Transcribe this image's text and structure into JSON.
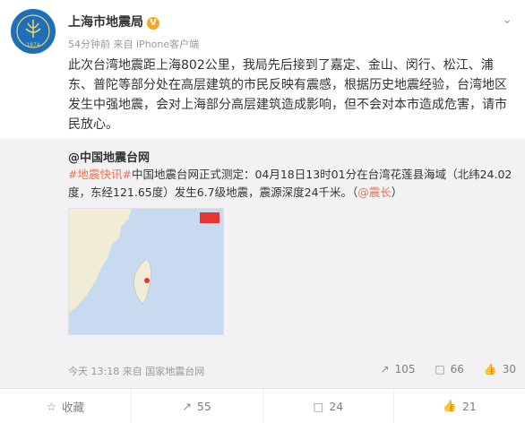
{
  "post": {
    "author": "上海市地震局",
    "verified_badge": "V",
    "meta_time": "54分钟前",
    "meta_from": "来自",
    "meta_source": "iPhone客户端",
    "text": "此次台湾地震距上海802公里，我局先后接到了嘉定、金山、闵行、松江、浦东、普陀等部分处在高层建筑的市民反映有震感，根据历史地震经验，台湾地区发生中强地震，会对上海部分高层建筑造成影响，但不会对本市造成危害，请市民放心。",
    "avatar_year": "1874"
  },
  "repost": {
    "author": "@中国地震台网",
    "hashtag": "#地震快讯#",
    "text": "中国地震台网正式测定：04月18日13时01分在台湾花莲县海域（北纬24.02度，东经121.65度）发生6.7级地震，震源深度24千米。（",
    "mention": "@震长",
    "text_end": "）",
    "time": "今天 13:18",
    "from": "来自",
    "source": "国家地震台网",
    "reposts": "105",
    "comments": "66",
    "likes": "30"
  },
  "actions": {
    "favorite": "收藏",
    "repost": "55",
    "comment": "24",
    "like": "21"
  },
  "colors": {
    "link": "#eb7350",
    "badge": "#f5a623",
    "repost_bg": "#f2f2f5"
  }
}
